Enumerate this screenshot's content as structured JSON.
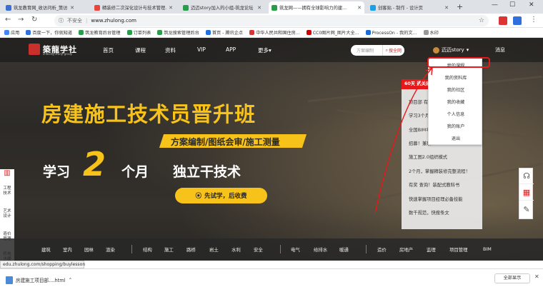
{
  "browser": {
    "tabs": [
      {
        "title": "筑龙教育网_收访问析_策访问析",
        "color": "#3b6fd1",
        "active": false
      },
      {
        "title": "精装修二次深化设计与技术管理...",
        "color": "#e8453c",
        "active": false
      },
      {
        "title": "迈迈story加入的小组-筑龙论坛",
        "color": "#2a9d4a",
        "active": false
      },
      {
        "title": "筑龙网——拥有全球影响力的建...",
        "color": "#2a9d4a",
        "active": true
      },
      {
        "title": "创客贴 - 制作 - 设计页",
        "color": "#1aa0e6",
        "active": false
      }
    ],
    "new_tab": "+",
    "window_controls": [
      "—",
      "☐",
      "✕"
    ],
    "address": {
      "security": "不安全",
      "url": "www.zhulong.com"
    },
    "bookmarks": [
      {
        "label": "应用",
        "color": "#4285f4"
      },
      {
        "label": "百度一下，你就知道",
        "color": "#2f6fde"
      },
      {
        "label": "筑龙教育后台管理",
        "color": "#2a9d4a"
      },
      {
        "label": "订单列表",
        "color": "#2a9d4a"
      },
      {
        "label": "筑龙搜索管理后台",
        "color": "#2a9d4a"
      },
      {
        "label": "首页 - 腾讯企点",
        "color": "#1e6fe0"
      },
      {
        "label": "中华人民共和国住房...",
        "color": "#d33"
      },
      {
        "label": "CC0图片网_图片大全...",
        "color": "#c00"
      },
      {
        "label": "ProcessOn - 我的文...",
        "color": "#1a6ad8"
      },
      {
        "label": "水印",
        "color": "#999"
      }
    ]
  },
  "site": {
    "logo": {
      "name": "築龍学社",
      "tagline": "zhulong study group"
    },
    "nav": [
      "首页",
      "课程",
      "资料",
      "VIP",
      "APP",
      "更多▾"
    ],
    "search": {
      "placeholder": "方案编制",
      "button": "搜全网"
    },
    "user": {
      "name": "迈迈story",
      "caret": "▾"
    },
    "message": "消息",
    "user_menu": [
      "我的课程",
      "我的资料库",
      "我的社区",
      "我的收藏",
      "个人信息",
      "我的账户",
      "退出"
    ],
    "banner": {
      "headline": "房建施工技术员晋升班",
      "subtitle": "方案编制/图纸会审/施工测量",
      "line_study": "学习",
      "big_number": "2",
      "line_months": "个月",
      "line_skill": "独立干技术",
      "cta": "先试学，后收费"
    },
    "news": {
      "header": "60天 通关成功",
      "items": [
        "项目部 有这",
        "学习3个月，",
        "全国BIM考",
        "招募！兼职",
        "施工图2.0组织模式",
        "2个月，掌握精装修完整流程！",
        "有奖 查询！装配式教科书",
        "快速掌握项目经理必备技能",
        "数千规范，快搜条文"
      ]
    },
    "left_tools": [
      [
        "工程",
        "技术"
      ],
      [
        "艺术",
        "设计"
      ],
      [
        "造价",
        "管理"
      ],
      [
        "机电",
        "水暖"
      ]
    ],
    "categories": [
      "建筑",
      "室内",
      "园林",
      "渲染",
      "结构",
      "施工",
      "路桥",
      "岩土",
      "水利",
      "安全",
      "电气",
      "给排水",
      "暖通",
      "造价",
      "房地产",
      "监理",
      "项目管理",
      "BIM"
    ]
  },
  "status_url": "edu.zhulong.com/shopping/buylesson",
  "download": {
    "file": "房建施工项目部....html",
    "show_all": "全部显示"
  },
  "colors": {
    "brand_red": "#e8171a",
    "brand_yellow": "#f7c31a"
  }
}
